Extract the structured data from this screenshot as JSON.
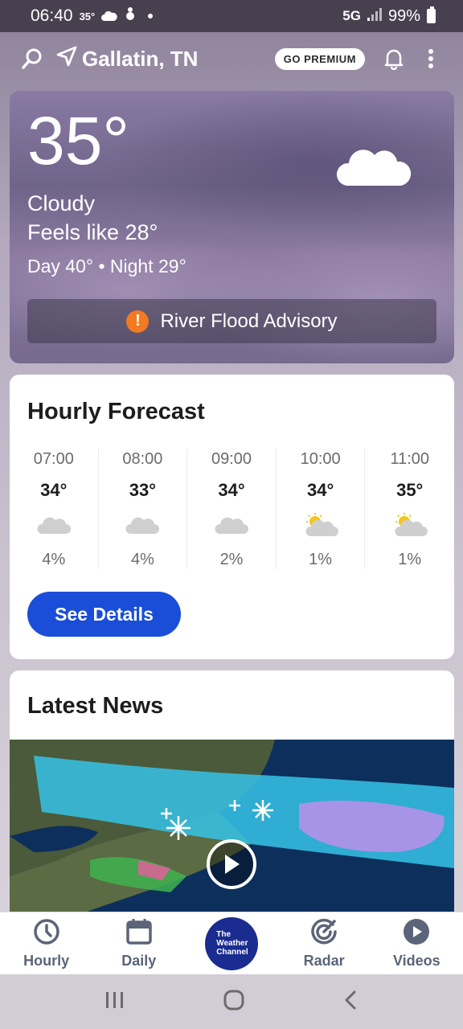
{
  "status_bar": {
    "time": "06:40",
    "temp": "35°",
    "network": "5G",
    "battery": "99%"
  },
  "top_bar": {
    "location": "Gallatin, TN",
    "premium_label": "GO PREMIUM"
  },
  "current": {
    "temperature": "35°",
    "condition": "Cloudy",
    "feels_like": "Feels like 28°",
    "day_night": "Day 40° • Night 29°",
    "advisory": "River Flood Advisory",
    "alert_symbol": "!"
  },
  "hourly": {
    "title": "Hourly Forecast",
    "items": [
      {
        "time": "07:00",
        "temp": "34°",
        "icon": "cloud-icon",
        "precip": "4%"
      },
      {
        "time": "08:00",
        "temp": "33°",
        "icon": "cloud-icon",
        "precip": "4%"
      },
      {
        "time": "09:00",
        "temp": "34°",
        "icon": "cloud-icon",
        "precip": "2%"
      },
      {
        "time": "10:00",
        "temp": "34°",
        "icon": "partly-sunny-icon",
        "precip": "1%"
      },
      {
        "time": "11:00",
        "temp": "35°",
        "icon": "partly-sunny-icon",
        "precip": "1%"
      }
    ],
    "details_label": "See Details"
  },
  "news": {
    "title": "Latest News"
  },
  "bottom_nav": {
    "hourly": "Hourly",
    "daily": "Daily",
    "logo_line1": "The",
    "logo_line2": "Weather",
    "logo_line3": "Channel",
    "radar": "Radar",
    "videos": "Videos"
  },
  "colors": {
    "accent_blue": "#1a4ed8",
    "alert_orange": "#f27a21",
    "logo_navy": "#1a2c8f"
  }
}
